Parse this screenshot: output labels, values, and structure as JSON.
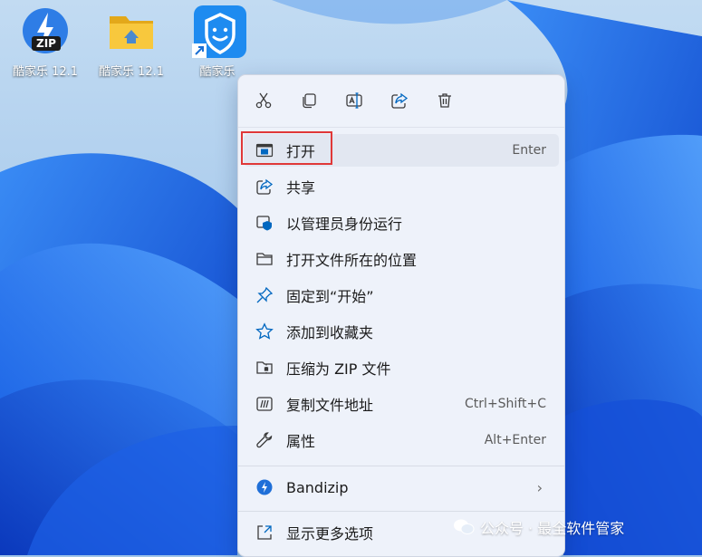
{
  "desktop": {
    "icons": [
      {
        "label": "酷家乐 12.1",
        "icon": "zip-app-icon",
        "badge": "ZIP"
      },
      {
        "label": "酷家乐 12.1",
        "icon": "folder-icon"
      },
      {
        "label": "酷家乐",
        "icon": "kujiale-shortcut-icon"
      }
    ]
  },
  "context_menu": {
    "toolbar": [
      {
        "name": "cut",
        "icon": "scissors-icon"
      },
      {
        "name": "copy",
        "icon": "copy-icon"
      },
      {
        "name": "rename",
        "icon": "rename-icon"
      },
      {
        "name": "share",
        "icon": "share-icon"
      },
      {
        "name": "delete",
        "icon": "trash-icon"
      }
    ],
    "items": [
      {
        "label": "打开",
        "shortcut": "Enter",
        "icon": "open-window-icon"
      },
      {
        "label": "共享",
        "shortcut": "",
        "icon": "share-icon"
      },
      {
        "label": "以管理员身份运行",
        "shortcut": "",
        "icon": "shield-icon"
      },
      {
        "label": "打开文件所在的位置",
        "shortcut": "",
        "icon": "folder-icon"
      },
      {
        "label": "固定到“开始”",
        "shortcut": "",
        "icon": "pin-icon"
      },
      {
        "label": "添加到收藏夹",
        "shortcut": "",
        "icon": "star-icon"
      },
      {
        "label": "压缩为 ZIP 文件",
        "shortcut": "",
        "icon": "zip-folder-icon"
      },
      {
        "label": "复制文件地址",
        "shortcut": "Ctrl+Shift+C",
        "icon": "path-icon"
      },
      {
        "label": "属性",
        "shortcut": "Alt+Enter",
        "icon": "wrench-icon"
      },
      {
        "label": "Bandizip",
        "shortcut": "",
        "icon": "bandizip-icon"
      },
      {
        "label": "显示更多选项",
        "shortcut": "",
        "icon": "more-options-icon"
      }
    ]
  },
  "watermark": {
    "text": "公众号 · 最全软件管家"
  },
  "colors": {
    "accent": "#0067c0",
    "highlight_border": "#e03838",
    "menu_bg": "#eef2fa"
  }
}
